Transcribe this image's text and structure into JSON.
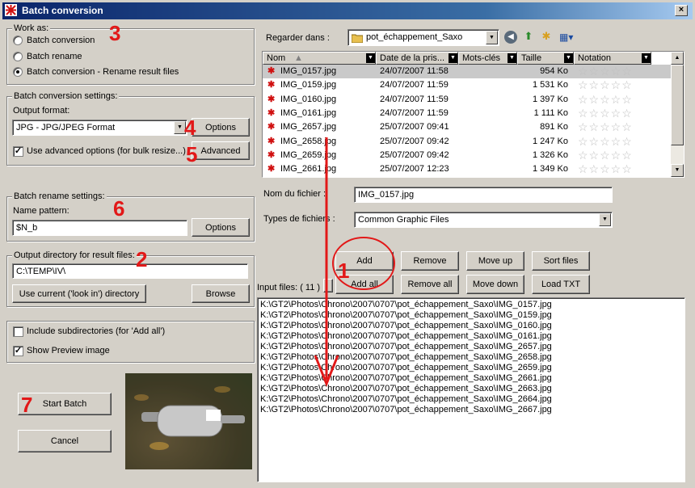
{
  "window": {
    "title": "Batch conversion",
    "close": "×"
  },
  "work_as": {
    "label": "Work as:",
    "options": [
      "Batch conversion",
      "Batch rename",
      "Batch conversion - Rename result files"
    ],
    "selected": 2
  },
  "conversion": {
    "label": "Batch conversion settings:",
    "format_label": "Output format:",
    "format_value": "JPG - JPG/JPEG Format",
    "options_button": "Options",
    "advanced_check": "Use advanced options (for bulk resize...)",
    "advanced_checked": true,
    "advanced_button": "Advanced"
  },
  "rename": {
    "label": "Batch rename settings:",
    "pattern_label": "Name pattern:",
    "pattern_value": "$N_b",
    "options_button": "Options"
  },
  "output": {
    "label": "Output directory for result files:",
    "value": "C:\\TEMP\\IV\\",
    "use_current_button": "Use current ('look in') directory",
    "browse_button": "Browse"
  },
  "misc": {
    "include_subdirs": "Include subdirectories (for 'Add all')",
    "include_subdirs_checked": false,
    "show_preview": "Show Preview image",
    "show_preview_checked": true
  },
  "actions": {
    "start": "Start Batch",
    "cancel": "Cancel"
  },
  "lookin": {
    "label": "Regarder dans :",
    "value": "pot_échappement_Saxo"
  },
  "columns": [
    "Nom",
    "Date de la pris...",
    "Mots-clés",
    "Taille",
    "Notation"
  ],
  "files": [
    {
      "name": "IMG_0157.jpg",
      "date": "24/07/2007 11:58",
      "size": "954 Ko",
      "selected": true
    },
    {
      "name": "IMG_0159.jpg",
      "date": "24/07/2007 11:59",
      "size": "1 531 Ko"
    },
    {
      "name": "IMG_0160.jpg",
      "date": "24/07/2007 11:59",
      "size": "1 397 Ko"
    },
    {
      "name": "IMG_0161.jpg",
      "date": "24/07/2007 11:59",
      "size": "1 111 Ko"
    },
    {
      "name": "IMG_2657.jpg",
      "date": "25/07/2007 09:41",
      "size": "891 Ko"
    },
    {
      "name": "IMG_2658.jpg",
      "date": "25/07/2007 09:42",
      "size": "1 247 Ko"
    },
    {
      "name": "IMG_2659.jpg",
      "date": "25/07/2007 09:42",
      "size": "1 326 Ko"
    },
    {
      "name": "IMG_2661.jpg",
      "date": "25/07/2007 12:23",
      "size": "1 349 Ko"
    }
  ],
  "filename": {
    "label": "Nom du fichier :",
    "value": "IMG_0157.jpg"
  },
  "filetype": {
    "label": "Types de fichiers :",
    "value": "Common Graphic Files"
  },
  "list_buttons": {
    "add": "Add",
    "remove": "Remove",
    "move_up": "Move up",
    "sort": "Sort files",
    "add_all": "Add all",
    "remove_all": "Remove all",
    "move_down": "Move down",
    "load_txt": "Load TXT"
  },
  "input_files": {
    "label": "Input files: ( 11 )",
    "items": [
      "K:\\GT2\\Photos\\Chrono\\2007\\0707\\pot_échappement_Saxo\\IMG_0157.jpg",
      "K:\\GT2\\Photos\\Chrono\\2007\\0707\\pot_échappement_Saxo\\IMG_0159.jpg",
      "K:\\GT2\\Photos\\Chrono\\2007\\0707\\pot_échappement_Saxo\\IMG_0160.jpg",
      "K:\\GT2\\Photos\\Chrono\\2007\\0707\\pot_échappement_Saxo\\IMG_0161.jpg",
      "K:\\GT2\\Photos\\Chrono\\2007\\0707\\pot_échappement_Saxo\\IMG_2657.jpg",
      "K:\\GT2\\Photos\\Chrono\\2007\\0707\\pot_échappement_Saxo\\IMG_2658.jpg",
      "K:\\GT2\\Photos\\Chrono\\2007\\0707\\pot_échappement_Saxo\\IMG_2659.jpg",
      "K:\\GT2\\Photos\\Chrono\\2007\\0707\\pot_échappement_Saxo\\IMG_2661.jpg",
      "K:\\GT2\\Photos\\Chrono\\2007\\0707\\pot_échappement_Saxo\\IMG_2663.jpg",
      "K:\\GT2\\Photos\\Chrono\\2007\\0707\\pot_échappement_Saxo\\IMG_2664.jpg",
      "K:\\GT2\\Photos\\Chrono\\2007\\0707\\pot_échappement_Saxo\\IMG_2667.jpg"
    ]
  },
  "annotations": [
    "3",
    "4",
    "5",
    "6",
    "2",
    "1",
    "7"
  ],
  "annotation_color": "#e21818"
}
